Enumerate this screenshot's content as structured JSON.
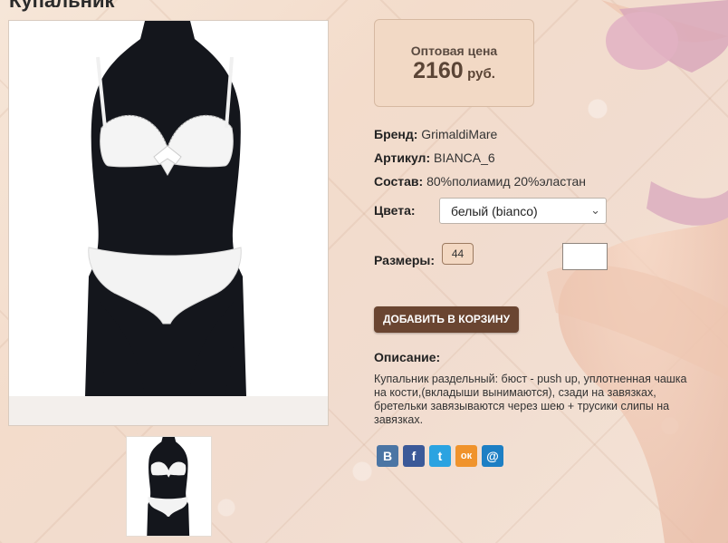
{
  "page": {
    "title": "Купальник"
  },
  "price": {
    "label": "Оптовая цена",
    "value": "2160",
    "currency": "руб."
  },
  "attributes": {
    "brand_label": "Бренд:",
    "brand_value": "GrimaldiMare",
    "sku_label": "Артикул:",
    "sku_value": "BIANCA_6",
    "composition_label": "Состав:",
    "composition_value": "80%полиамид 20%эластан",
    "colors_label": "Цвета:",
    "colors_selected": "белый (bianco)",
    "sizes_label": "Размеры:",
    "size_option": "44",
    "quantity_value": ""
  },
  "cart": {
    "button_label": "ДОБАВИТЬ В КОРЗИНУ"
  },
  "description": {
    "title": "Описание:",
    "text": "Купальник раздельный: бюст - push up, уплотненная чашка на кости,(вкладыши вынимаются), сзади на завязках, бретельки завязываются через шею + трусики слипы на завязках."
  },
  "share": {
    "icons": [
      "vk-icon",
      "facebook-icon",
      "twitter-icon",
      "odnoklassniki-icon",
      "mailru-icon"
    ],
    "glyphs": [
      "В",
      "f",
      "t",
      "ок",
      "@"
    ],
    "colors": [
      "#4b75a4",
      "#3b5998",
      "#2ba3e1",
      "#f0932c",
      "#1d7fc4"
    ]
  }
}
